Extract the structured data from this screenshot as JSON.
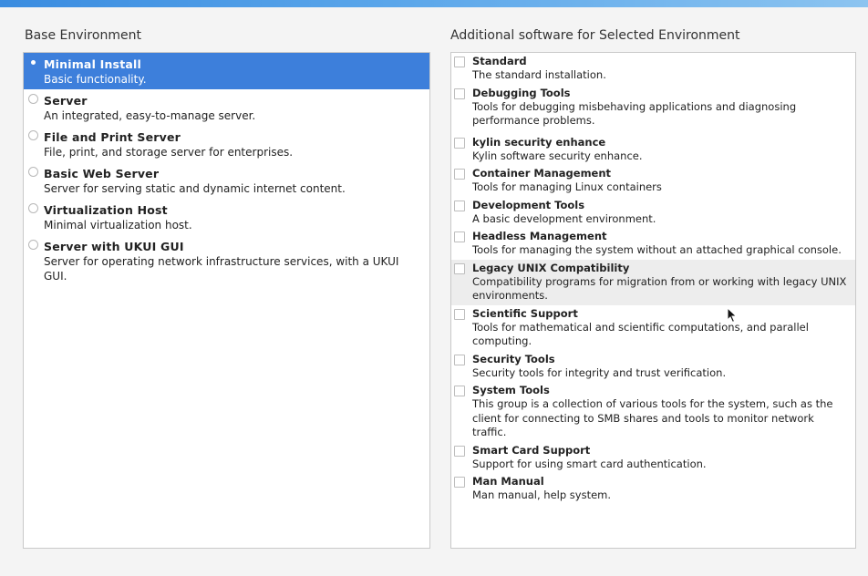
{
  "base_environment": {
    "title": "Base Environment",
    "items": [
      {
        "name": "Minimal Install",
        "desc": "Basic functionality.",
        "selected": true
      },
      {
        "name": "Server",
        "desc": "An integrated, easy-to-manage server.",
        "selected": false
      },
      {
        "name": "File and Print Server",
        "desc": "File, print, and storage server for enterprises.",
        "selected": false
      },
      {
        "name": "Basic Web Server",
        "desc": "Server for serving static and dynamic internet content.",
        "selected": false
      },
      {
        "name": "Virtualization Host",
        "desc": "Minimal virtualization host.",
        "selected": false
      },
      {
        "name": "Server with UKUI GUI",
        "desc": "Server for operating network infrastructure services, with a UKUI GUI.",
        "selected": false
      }
    ]
  },
  "additional_software": {
    "title": "Additional software for Selected Environment",
    "items": [
      {
        "name": "Standard",
        "desc": "The standard installation.",
        "checked": false
      },
      {
        "name": "Debugging Tools",
        "desc": "Tools for debugging misbehaving applications and diagnosing performance problems.",
        "checked": false
      },
      {
        "name": "kylin security enhance",
        "desc": "Kylin software security enhance.",
        "checked": false
      },
      {
        "name": "Container Management",
        "desc": "Tools for managing Linux containers",
        "checked": false
      },
      {
        "name": "Development Tools",
        "desc": "A basic development environment.",
        "checked": false
      },
      {
        "name": "Headless Management",
        "desc": "Tools for managing the system without an attached graphical console.",
        "checked": false
      },
      {
        "name": "Legacy UNIX Compatibility",
        "desc": "Compatibility programs for migration from or working with legacy UNIX environments.",
        "checked": false
      },
      {
        "name": "Scientific Support",
        "desc": "Tools for mathematical and scientific computations, and parallel computing.",
        "checked": false
      },
      {
        "name": "Security Tools",
        "desc": "Security tools for integrity and trust verification.",
        "checked": false
      },
      {
        "name": "System Tools",
        "desc": "This group is a collection of various tools for the system, such as the client for connecting to SMB shares and tools to monitor network traffic.",
        "checked": false
      },
      {
        "name": "Smart Card Support",
        "desc": "Support for using smart card authentication.",
        "checked": false
      },
      {
        "name": "Man Manual",
        "desc": "Man manual, help system.",
        "checked": false
      }
    ]
  },
  "colors": {
    "selection": "#3d7fdb",
    "accent_bar": "#5aa6ea"
  }
}
